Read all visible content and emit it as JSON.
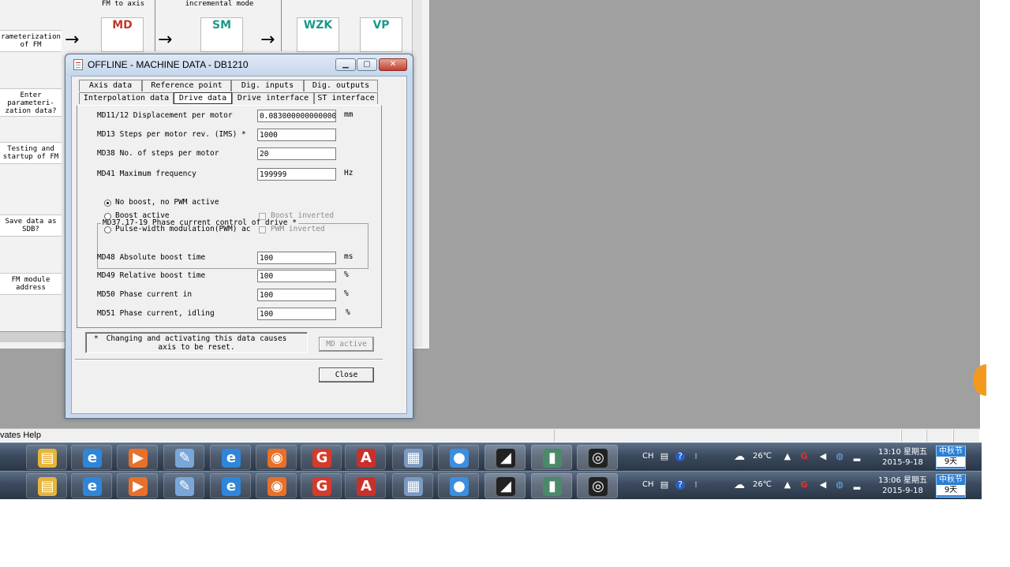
{
  "background": {
    "headers": [
      "FM to axis",
      "incremental mode"
    ],
    "steps": [
      "rameterization\nof FM",
      "Enter\nparameteri-\nzation data?",
      "Testing and\nstartup of FM",
      "Save data as\nSDB?",
      "FM module\naddress"
    ],
    "modules": [
      "MD",
      "SM",
      "WZK",
      "VP"
    ],
    "module_colors": [
      "#c0392b",
      "#1a9a8a",
      "#1a9a8a",
      "#1a9a8a"
    ],
    "status_text": "vates Help"
  },
  "dialog": {
    "title": "OFFLINE - MACHINE DATA - DB1210",
    "tabs_row1": [
      "Axis data",
      "Reference point",
      "Dig. inputs",
      "Dig. outputs"
    ],
    "tabs_row2": [
      "Interpolation data",
      "Drive data",
      "Drive interface",
      "ST interface"
    ],
    "active_tab": "Drive data",
    "fields": [
      {
        "label": "MD11/12 Displacement per motor",
        "value": "0.083000000000000",
        "unit": "mm"
      },
      {
        "label": "MD13 Steps per motor rev. (IMS) *",
        "value": "1000",
        "unit": ""
      },
      {
        "label": "MD38 No. of steps per motor",
        "value": "20",
        "unit": ""
      },
      {
        "label": "MD41 Maximum frequency",
        "value": "199999",
        "unit": "Hz"
      }
    ],
    "group": {
      "title": "MD37.17-19 Phase current control of drive *",
      "options": [
        {
          "label": "No boost, no PWM active",
          "selected": true
        },
        {
          "label": "Boost active",
          "selected": false
        },
        {
          "label": "Pulse-width modulation(PWM) ac",
          "selected": false
        }
      ],
      "checks": [
        {
          "label": "Boost inverted",
          "checked": false
        },
        {
          "label": "PWM inverted",
          "checked": false
        }
      ]
    },
    "fields2": [
      {
        "label": "MD48 Absolute boost time",
        "value": "100",
        "unit": "ms"
      },
      {
        "label": "MD49 Relative boost time",
        "value": "100",
        "unit": "%"
      },
      {
        "label": "MD50 Phase current in",
        "value": "100",
        "unit": "%"
      },
      {
        "label": "MD51 Phase current, idling",
        "value": "100",
        "unit": "%"
      }
    ],
    "note_star": "*",
    "note": "Changing and activating this data causes\naxis to be reset.",
    "md_active_label": "MD active",
    "close_label": "Close"
  },
  "taskbars": [
    {
      "clock_time": "13:10 星期五",
      "clock_date": "2015-9-18",
      "temperature": "26℃",
      "lang": "CH",
      "festival": "中秋节",
      "days": "9天"
    },
    {
      "clock_time": "13:06 星期五",
      "clock_date": "2015-9-18",
      "temperature": "26℃",
      "lang": "CH",
      "festival": "中秋节",
      "days": "9天"
    }
  ],
  "taskbar_apps": [
    {
      "icon": "folder-icon",
      "glyph": "▤",
      "color": "#e7b43a"
    },
    {
      "icon": "ie-icon",
      "glyph": "e",
      "color": "#2f86d8"
    },
    {
      "icon": "media-player-icon",
      "glyph": "▶",
      "color": "#e8702a"
    },
    {
      "icon": "paint-icon",
      "glyph": "✎",
      "color": "#7aa7d8"
    },
    {
      "icon": "ie-icon",
      "glyph": "e",
      "color": "#2f86d8"
    },
    {
      "icon": "firefox-icon",
      "glyph": "◉",
      "color": "#e8702a"
    },
    {
      "icon": "weibo-icon",
      "glyph": "G",
      "color": "#d63a2a"
    },
    {
      "icon": "pdf-icon",
      "glyph": "A",
      "color": "#c9302c"
    },
    {
      "icon": "calculator-icon",
      "glyph": "▦",
      "color": "#7a9ac2"
    },
    {
      "icon": "qq-icon",
      "glyph": "●",
      "color": "#3c8ee0"
    },
    {
      "icon": "simatic-icon",
      "glyph": "◢",
      "color": "#222222"
    },
    {
      "icon": "step7-icon",
      "glyph": "▮",
      "color": "#4a8a6a"
    },
    {
      "icon": "search-app-icon",
      "glyph": "◎",
      "color": "#222222"
    }
  ]
}
